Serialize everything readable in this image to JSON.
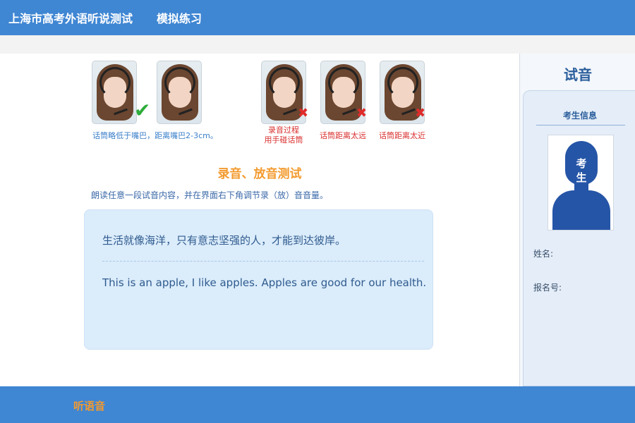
{
  "header": {
    "app_title": "上海市高考外语听说测试",
    "mode": "模拟练习"
  },
  "examples": [
    {
      "caption": "话筒略低于嘴巴，距离嘴巴2-3cm。",
      "status": "correct"
    },
    {
      "caption_lines": [
        "录音过程",
        "用手碰话筒"
      ],
      "status": "wrong"
    },
    {
      "caption": "话筒距离太远",
      "status": "wrong"
    },
    {
      "caption": "话筒距离太近",
      "status": "wrong"
    }
  ],
  "section": {
    "title": "录音、放音测试",
    "instruction": "朗读任意一段试音内容，并在界面右下角调节录（放）音音量。"
  },
  "reading": {
    "chinese": "生活就像海洋，只有意志坚强的人，才能到达彼岸。",
    "english": "This is an apple, I like apples. Apples are good for our health."
  },
  "sidebar": {
    "title": "试音",
    "panel_header": "考生信息",
    "photo_label": "考生",
    "name_label": "姓名:",
    "reg_label": "报名号:"
  },
  "footer": {
    "listen_label": "听语音"
  },
  "colors": {
    "header_blue": "#3f86d3",
    "accent_orange": "#f39a2e",
    "ok_green": "#2dac3a",
    "error_red": "#d9302f",
    "reading_box": "#dbecfb"
  }
}
